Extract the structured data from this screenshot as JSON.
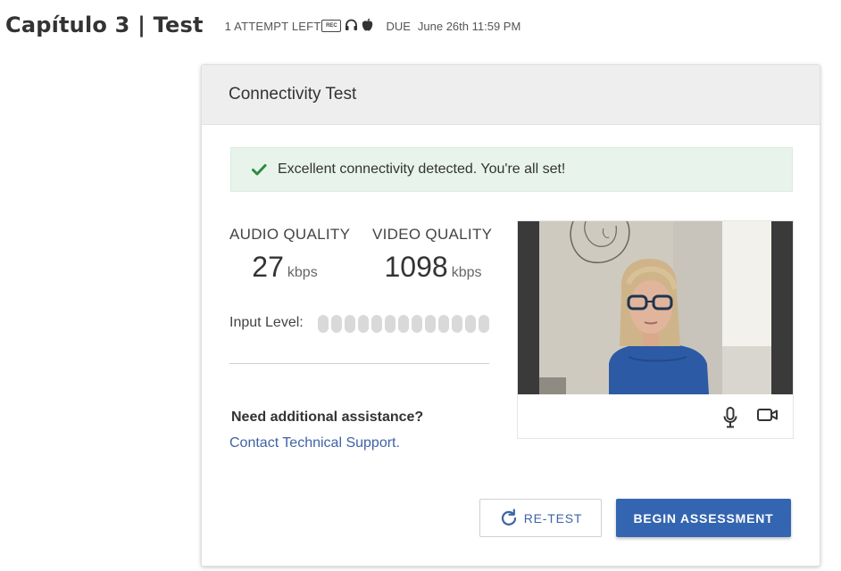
{
  "header": {
    "title": "Capítulo 3 | Test",
    "attempts": "1 ATTEMPT LEFT",
    "rec_badge": "REC",
    "due_label": "DUE",
    "due_value": "June 26th 11:59 PM"
  },
  "card": {
    "title": "Connectivity Test",
    "alert_text": "Excellent connectivity detected. You're all set!",
    "audio": {
      "label": "AUDIO QUALITY",
      "value": "27",
      "unit": "kbps"
    },
    "video": {
      "label": "VIDEO QUALITY",
      "value": "1098",
      "unit": "kbps"
    },
    "input_level": {
      "label": "Input Level:",
      "bars_total": 13,
      "bars_active": 0
    },
    "assistance": {
      "heading": "Need additional assistance?",
      "link": "Contact Technical Support."
    },
    "buttons": {
      "retest": "RE-TEST",
      "begin": "BEGIN ASSESSMENT"
    }
  },
  "colors": {
    "accent": "#3465b0",
    "link": "#3f63a6",
    "success_bg": "#e8f3eb",
    "success_icon": "#2e8b3e"
  },
  "icons": [
    "rec-icon",
    "headphones-icon",
    "apple-icon",
    "check-icon",
    "microphone-icon",
    "camera-icon",
    "refresh-icon"
  ]
}
